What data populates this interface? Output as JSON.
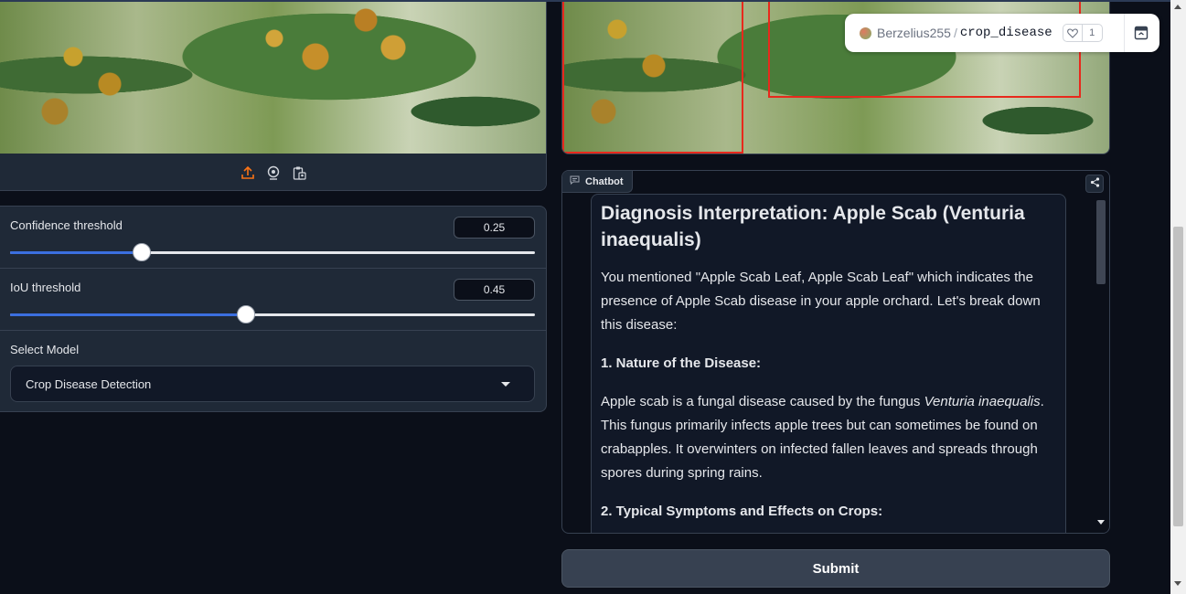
{
  "space": {
    "owner": "Berzelius255",
    "separator": "/",
    "repo": "crop_disease",
    "likes": "1"
  },
  "toolbar": {
    "icons": [
      "upload-icon",
      "webcam-icon",
      "clipboard-icon"
    ]
  },
  "sliders": [
    {
      "label": "Confidence threshold",
      "value": "0.25",
      "fraction": 0.25
    },
    {
      "label": "IoU threshold",
      "value": "0.45",
      "fraction": 0.45
    }
  ],
  "select": {
    "label": "Select Model",
    "value": "Crop Disease Detection"
  },
  "chatbot": {
    "tag": "Chatbot",
    "heading": "Diagnosis Interpretation: Apple Scab (Venturia inaequalis)",
    "p1": "You mentioned \"Apple Scab Leaf, Apple Scab Leaf\" which indicates the presence of Apple Scab disease in your apple orchard. Let's break down this disease:",
    "section1": "1. Nature of the Disease:",
    "p2_before": "Apple scab is a fungal disease caused by the fungus ",
    "p2_italic": "Venturia inaequalis",
    "p2_after": ". This fungus primarily infects apple trees but can sometimes be found on crabapples. It overwinters on infected fallen leaves and spreads through spores during spring rains.",
    "section2": "2. Typical Symptoms and Effects on Crops:"
  },
  "submit": {
    "label": "Submit"
  },
  "colors": {
    "background": "#0b0f19",
    "panel": "#1f2937",
    "slider_fill": "#3b6fe0",
    "bbox": "#e8291c",
    "upload_accent": "#f97316"
  }
}
